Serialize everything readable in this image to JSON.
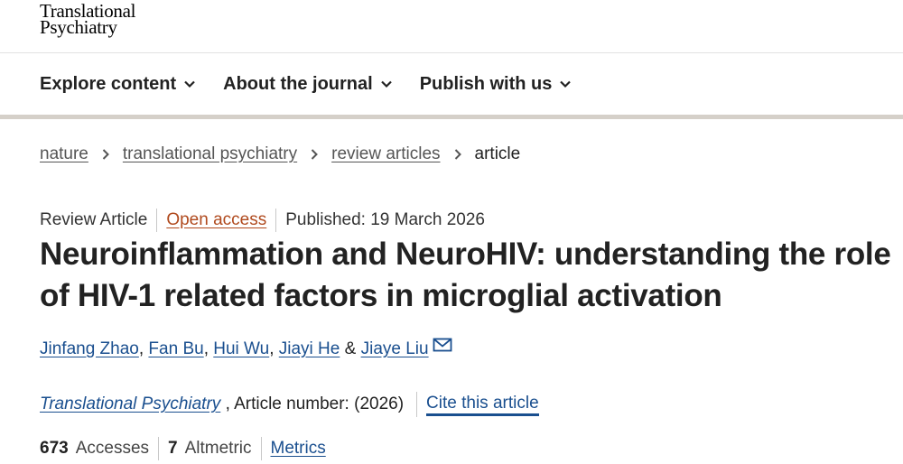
{
  "logo": {
    "line1": "Translational",
    "line2": "Psychiatry"
  },
  "nav": {
    "items": [
      {
        "label": "Explore content"
      },
      {
        "label": "About the journal"
      },
      {
        "label": "Publish with us"
      }
    ]
  },
  "breadcrumb": {
    "items": [
      "nature",
      "translational psychiatry",
      "review articles"
    ],
    "current": "article"
  },
  "meta": {
    "type": "Review Article",
    "access": "Open access",
    "published": "Published: 19 March 2026"
  },
  "title": "Neuroinflammation and NeuroHIV: understanding the role of HIV-1 related factors in microglial activation",
  "authors": {
    "list": [
      "Jinfang Zhao",
      "Fan Bu",
      "Hui Wu",
      "Jiayi He",
      "Jiaye Liu"
    ],
    "separator": ",",
    "last_join": "&"
  },
  "citation": {
    "journal": "Translational Psychiatry",
    "article_number": ", Article number: ",
    "year": "(2026)",
    "cite_label": "Cite this article"
  },
  "metrics": {
    "accesses_count": "673",
    "accesses_label": "Accesses",
    "altmetric_count": "7",
    "altmetric_label": "Altmetric",
    "metrics_link": "Metrics"
  },
  "colors": {
    "link": "#1a4f8f",
    "open_access": "#b04a1e",
    "nav_bar": "#d5d0c9"
  },
  "icons": {
    "nav_chevron": "chevron-down-icon",
    "breadcrumb_separator": "chevron-right-icon",
    "author_mail": "mail-icon"
  }
}
